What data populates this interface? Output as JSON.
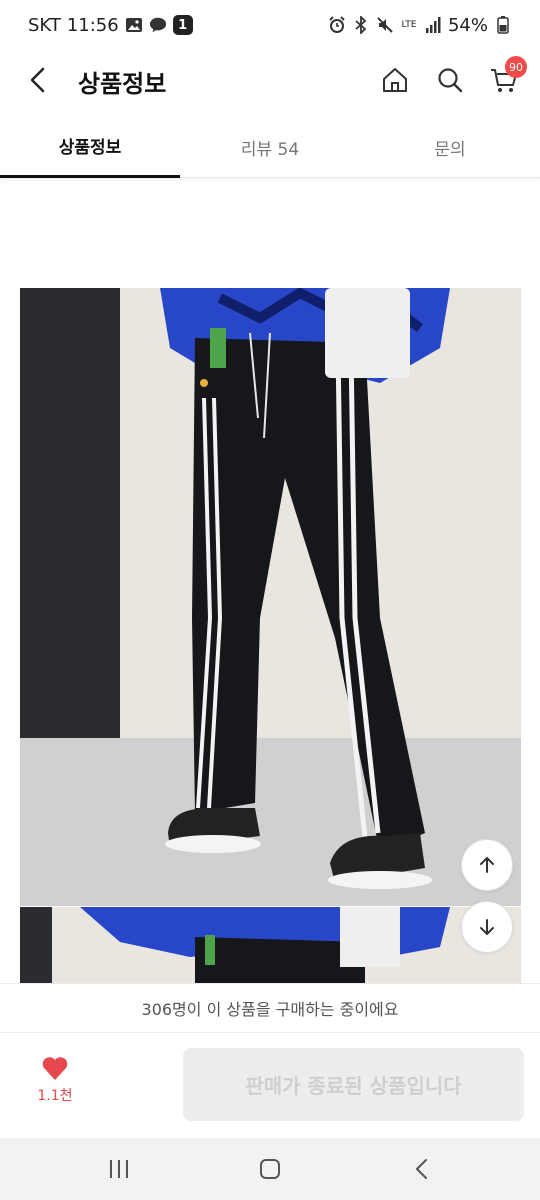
{
  "status_bar": {
    "carrier": "SKT",
    "time": "11:56",
    "talk_label": "TALK",
    "notification_count": "1",
    "network": "LTE",
    "battery": "54%"
  },
  "header": {
    "title": "상품정보",
    "cart_count": "90"
  },
  "tabs": [
    {
      "label": "상품정보",
      "active": true
    },
    {
      "label": "리뷰 54",
      "active": false
    },
    {
      "label": "문의",
      "active": false
    }
  ],
  "notice": {
    "text": "306명이 이 상품을 구매하는 중이에요"
  },
  "bottom_bar": {
    "like_count": "1.1천",
    "action_label": "판매가 종료된 상품입니다"
  },
  "colors": {
    "accent_red": "#e5484d",
    "cart_badge": "#ef4b4b",
    "disabled_bg": "#ededed",
    "disabled_text": "#cfcfcf"
  },
  "icons": [
    "alarm-icon",
    "bluetooth-icon",
    "mute-icon",
    "signal-icon",
    "battery-icon",
    "back-icon",
    "home-icon",
    "search-icon",
    "cart-icon",
    "arrow-up-icon",
    "arrow-down-icon",
    "heart-icon"
  ]
}
